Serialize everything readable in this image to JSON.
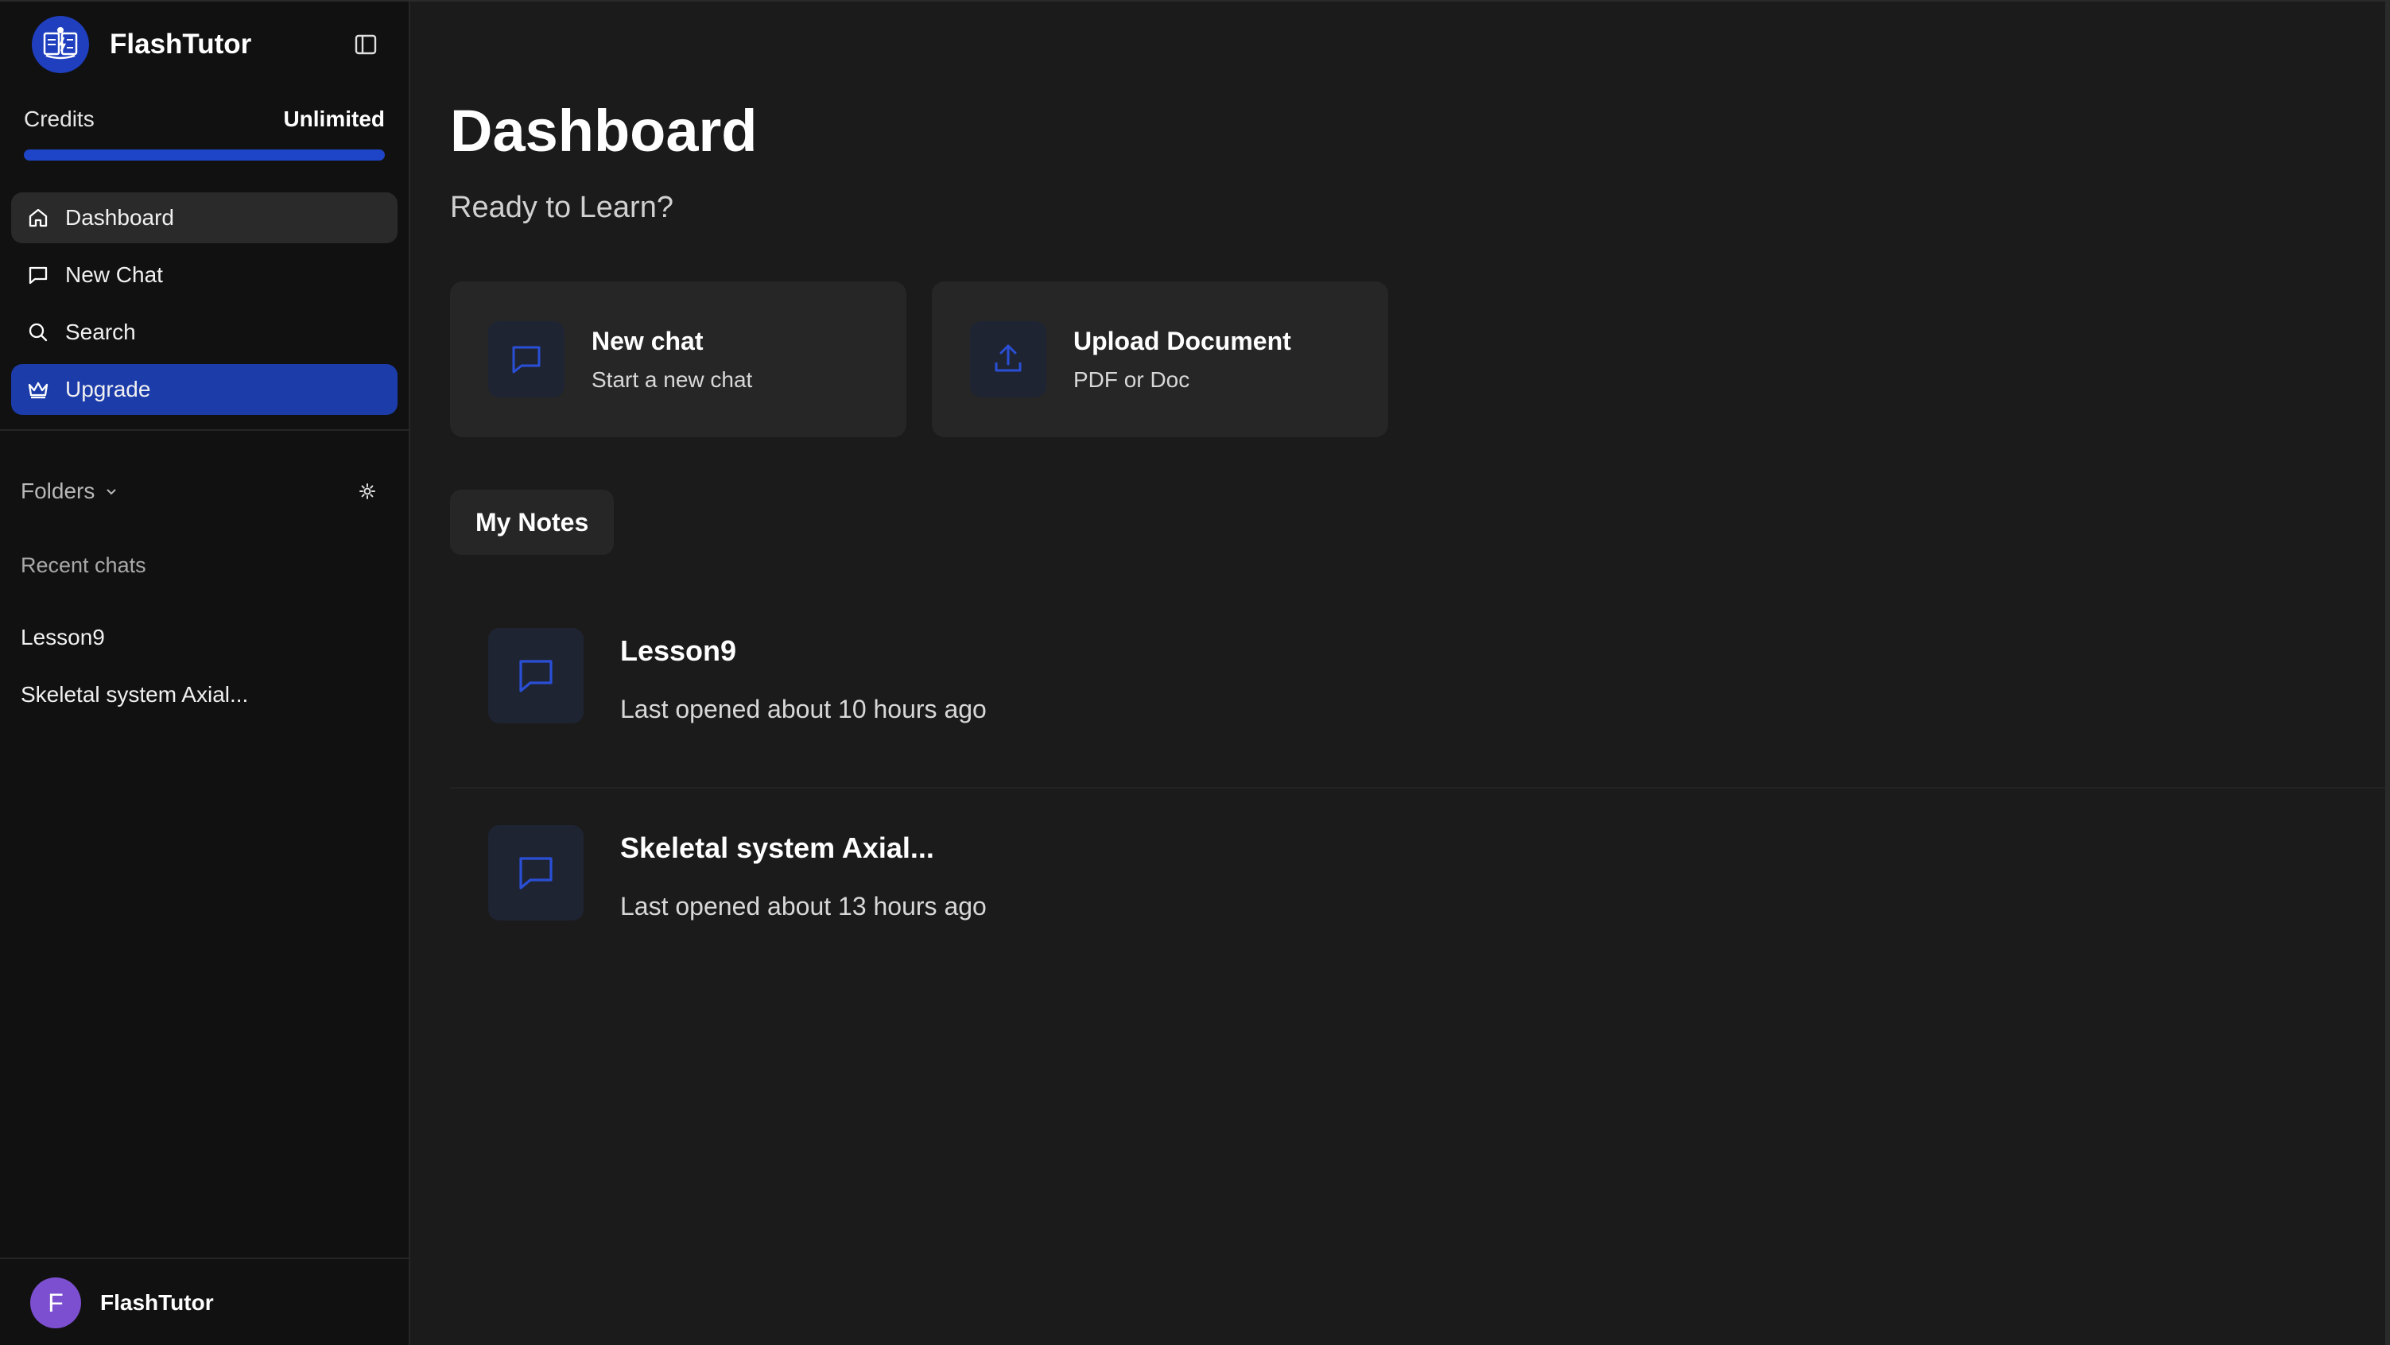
{
  "app": {
    "name": "FlashTutor"
  },
  "credits": {
    "label": "Credits",
    "value": "Unlimited",
    "fill_fraction": 1.0
  },
  "nav": {
    "items": [
      {
        "label": "Dashboard",
        "icon": "home-icon",
        "active": true
      },
      {
        "label": "New Chat",
        "icon": "message-icon"
      },
      {
        "label": "Search",
        "icon": "search-icon"
      },
      {
        "label": "Upgrade",
        "icon": "crown-icon",
        "highlight": true
      }
    ]
  },
  "folders": {
    "label": "Folders"
  },
  "recent": {
    "label": "Recent chats",
    "items": [
      {
        "label": "Lesson9"
      },
      {
        "label": "Skeletal system Axial..."
      }
    ]
  },
  "user": {
    "initial": "F",
    "name": "FlashTutor"
  },
  "main": {
    "title": "Dashboard",
    "subtitle": "Ready to Learn?",
    "cards": [
      {
        "title": "New chat",
        "subtitle": "Start a new chat",
        "icon": "message-icon"
      },
      {
        "title": "Upload Document",
        "subtitle": "PDF or Doc",
        "icon": "upload-icon"
      }
    ],
    "notes_tab": "My Notes",
    "notes": [
      {
        "title": "Lesson9",
        "time": "Last opened about 10 hours ago"
      },
      {
        "title": "Skeletal system Axial...",
        "time": "Last opened about 13 hours ago"
      }
    ]
  },
  "colors": {
    "accent": "#1e45c7",
    "upgrade_bg": "#1c3caa",
    "avatar": "#7c4fd0",
    "sidebar_bg": "#111111",
    "main_bg": "#1b1b1b",
    "card_bg": "#262626"
  }
}
